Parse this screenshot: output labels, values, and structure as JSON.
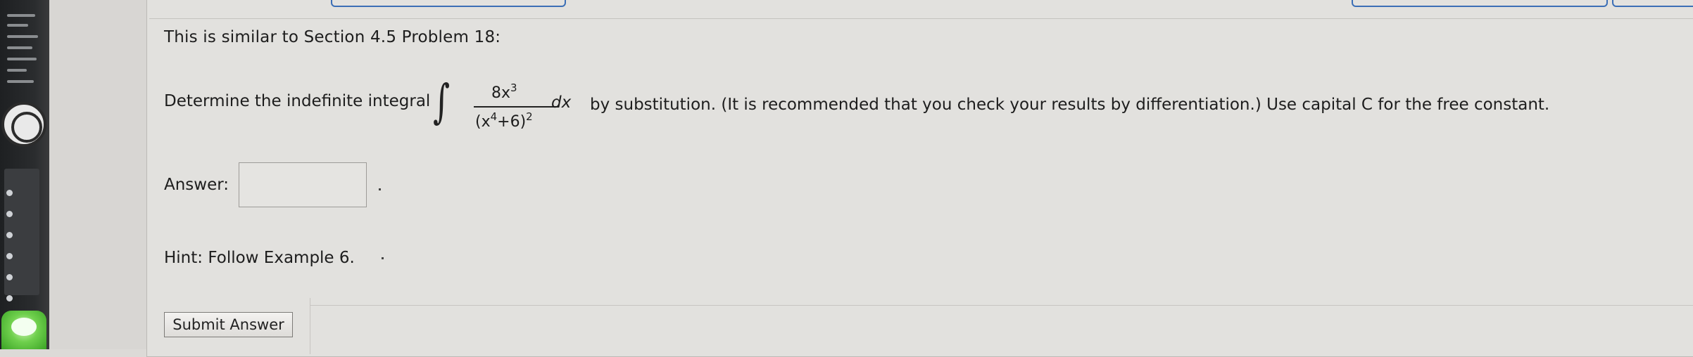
{
  "question": {
    "title": "This is similar to Section 4.5 Problem 18:",
    "prompt_prefix": "Determine the indefinite integral",
    "integral": {
      "numerator_base": "8x",
      "numerator_exp": "3",
      "denominator_open": "(x",
      "denominator_inner_exp": "4",
      "denominator_rest": "+6)",
      "denominator_exp": "2",
      "differential": "dx"
    },
    "prompt_suffix": "by substitution. (It is recommended that you check your results by differentiation.) Use capital C for the free constant."
  },
  "answer": {
    "label": "Answer:",
    "value": "",
    "trailing": "."
  },
  "hint": {
    "text": "Hint: Follow Example 6."
  },
  "actions": {
    "submit_label": "Submit Answer"
  },
  "colors": {
    "tab_outline": "#3c6fb6",
    "background": "#e2e1de"
  }
}
